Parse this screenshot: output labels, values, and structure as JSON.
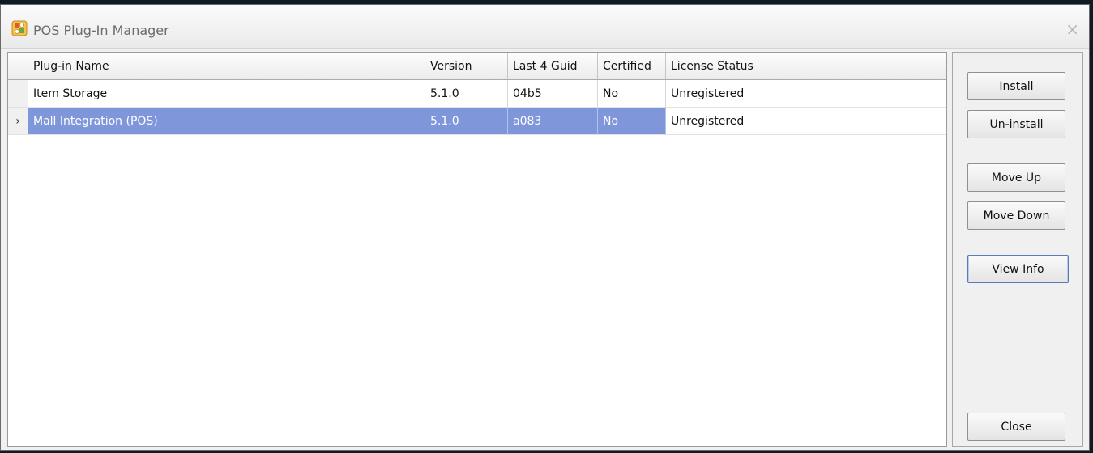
{
  "window": {
    "title": "POS Plug-In Manager",
    "close_glyph": "×",
    "icon": "plugin-app-icon"
  },
  "grid": {
    "columns": [
      "Plug-in Name",
      "Version",
      "Last 4 Guid",
      "Certified",
      "License Status"
    ],
    "rows": [
      {
        "name": "Item Storage",
        "version": "5.1.0",
        "guid": "04b5",
        "certified": "No",
        "license": "Unregistered",
        "selected": false
      },
      {
        "name": "Mall Integration (POS)",
        "version": "5.1.0",
        "guid": "a083",
        "certified": "No",
        "license": "Unregistered",
        "selected": true
      }
    ],
    "row_indicator": "›",
    "selection_color": "#7f96db"
  },
  "buttons": {
    "install": "Install",
    "uninstall": "Un-install",
    "move_up": "Move Up",
    "move_down": "Move Down",
    "view_info": "View Info",
    "close": "Close"
  }
}
